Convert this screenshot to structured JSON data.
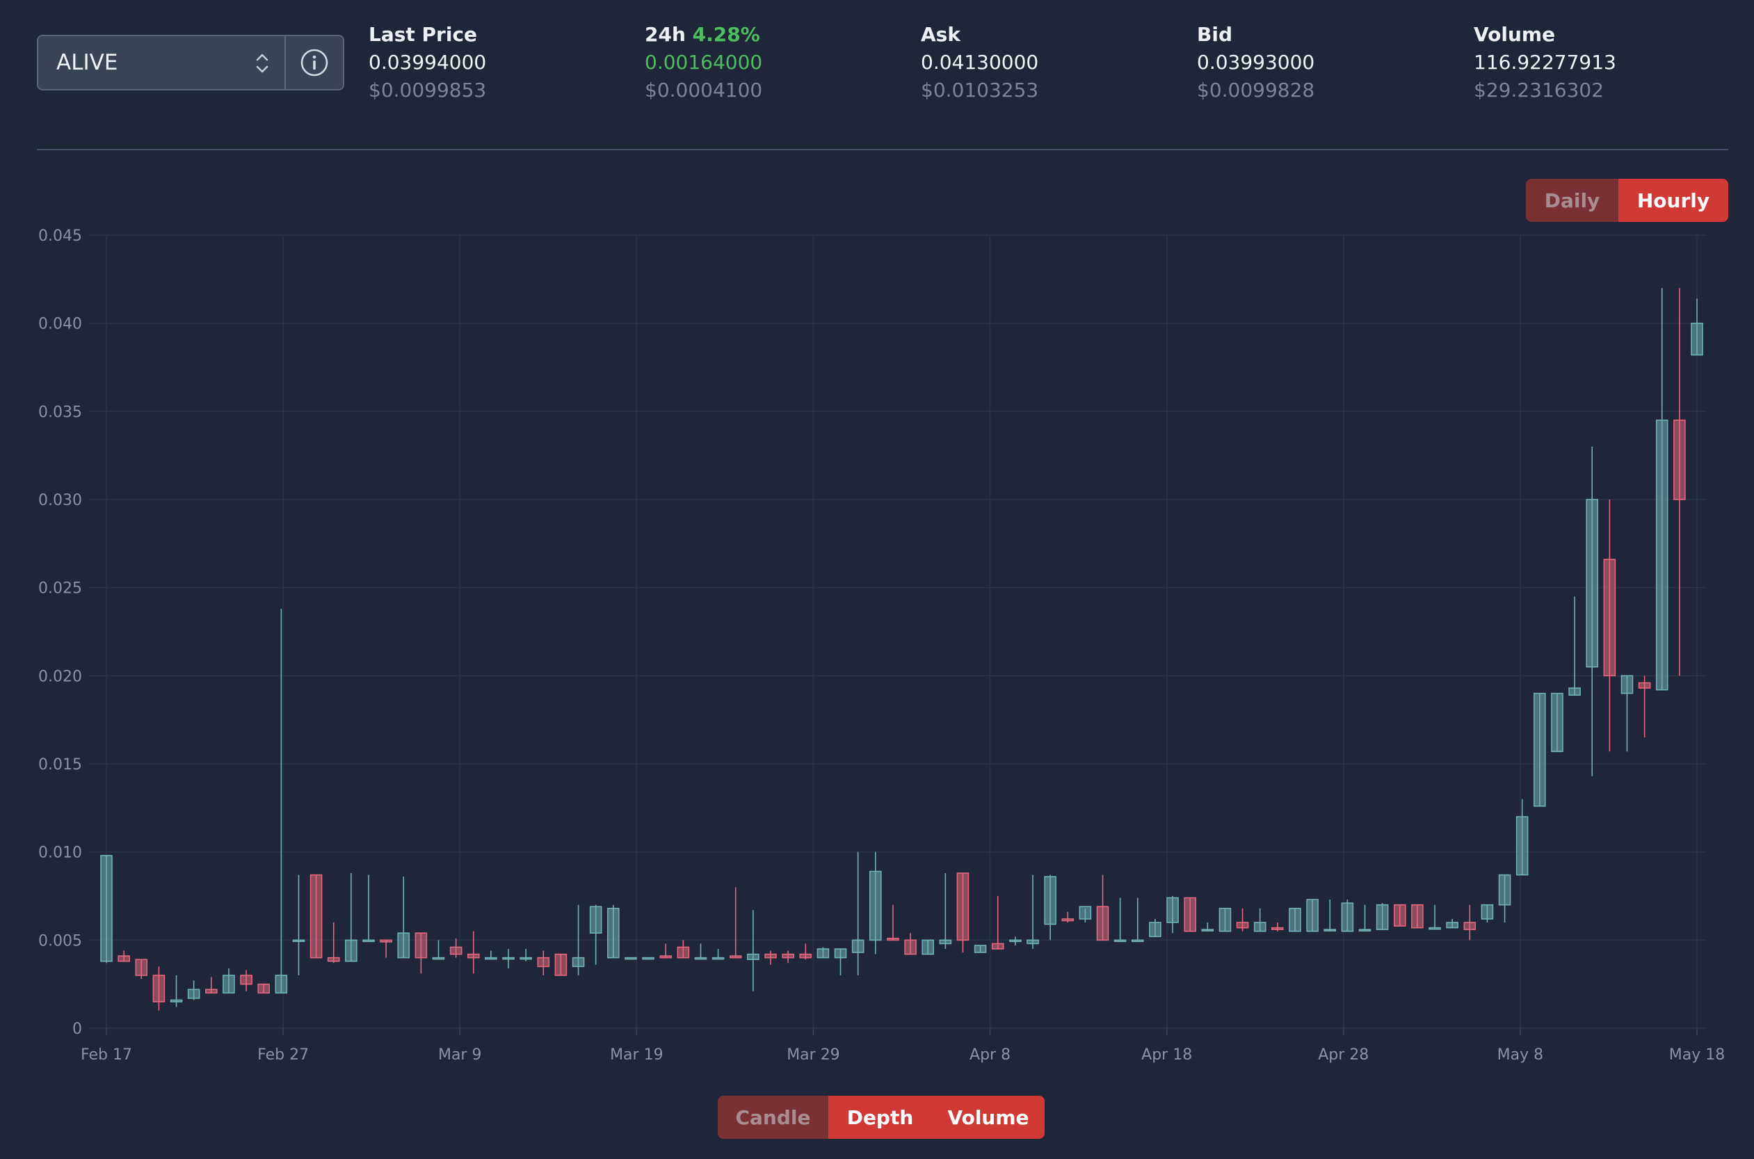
{
  "selector": {
    "value": "ALIVE",
    "chevron_icon": "chevron-up-down-icon",
    "info_icon": "info-circle-icon"
  },
  "stats": {
    "last_price": {
      "label": "Last Price",
      "value": "0.03994000",
      "usd": "$0.0099853"
    },
    "change_24h": {
      "label": "24h",
      "percent": "4.28%",
      "value": "0.00164000",
      "usd": "$0.0004100"
    },
    "ask": {
      "label": "Ask",
      "value": "0.04130000",
      "usd": "$0.0103253"
    },
    "bid": {
      "label": "Bid",
      "value": "0.03993000",
      "usd": "$0.0099828"
    },
    "volume": {
      "label": "Volume",
      "value": "116.92277913",
      "usd": "$29.2316302"
    }
  },
  "interval_toggle": {
    "options": [
      "Daily",
      "Hourly"
    ],
    "active": "Hourly"
  },
  "view_toggle": {
    "options": [
      "Candle",
      "Depth",
      "Volume"
    ],
    "active": "Candle"
  },
  "colors": {
    "up": "#6fb1b6",
    "down": "#e4677d",
    "accent": "#d03935",
    "positive": "#4dbd5f"
  },
  "chart_data": {
    "type": "candlestick",
    "x_start": "Feb 17",
    "x_end": "May 18",
    "x_ticks": [
      "Feb 17",
      "Feb 27",
      "Mar 9",
      "Mar 19",
      "Mar 29",
      "Apr 8",
      "Apr 18",
      "Apr 28",
      "May 8",
      "May 18"
    ],
    "y_ticks": [
      "0",
      "0.005",
      "0.010",
      "0.015",
      "0.020",
      "0.025",
      "0.030",
      "0.035",
      "0.040",
      "0.045"
    ],
    "ylim": [
      0,
      0.045
    ],
    "grid": true,
    "columns": [
      "date",
      "open",
      "high",
      "low",
      "close"
    ],
    "candles": [
      [
        "Feb 17",
        0.0038,
        0.0098,
        0.0037,
        0.0098
      ],
      [
        "Feb 18",
        0.0041,
        0.0044,
        0.0038,
        0.0038
      ],
      [
        "Feb 19",
        0.0039,
        0.0039,
        0.0028,
        0.003
      ],
      [
        "Feb 20",
        0.003,
        0.0035,
        0.001,
        0.0015
      ],
      [
        "Feb 21",
        0.0015,
        0.003,
        0.0012,
        0.0016
      ],
      [
        "Feb 22",
        0.0017,
        0.0027,
        0.0016,
        0.0022
      ],
      [
        "Feb 23",
        0.0022,
        0.0029,
        0.002,
        0.002
      ],
      [
        "Feb 24",
        0.002,
        0.0034,
        0.002,
        0.003
      ],
      [
        "Feb 25",
        0.003,
        0.0033,
        0.0021,
        0.0025
      ],
      [
        "Feb 26",
        0.0025,
        0.0025,
        0.002,
        0.002
      ],
      [
        "Feb 27",
        0.002,
        0.0238,
        0.002,
        0.003
      ],
      [
        "Feb 28",
        0.005,
        0.0087,
        0.003,
        0.005
      ],
      [
        "Mar 1",
        0.0087,
        0.0087,
        0.004,
        0.004
      ],
      [
        "Mar 2",
        0.004,
        0.006,
        0.0037,
        0.0038
      ],
      [
        "Mar 3",
        0.0038,
        0.0088,
        0.0038,
        0.005
      ],
      [
        "Mar 4",
        0.005,
        0.0087,
        0.005,
        0.005
      ],
      [
        "Mar 5",
        0.005,
        0.005,
        0.004,
        0.0049
      ],
      [
        "Mar 6",
        0.004,
        0.0086,
        0.004,
        0.0054
      ],
      [
        "Mar 7",
        0.0054,
        0.0054,
        0.0031,
        0.004
      ],
      [
        "Mar 8",
        0.004,
        0.005,
        0.004,
        0.004
      ],
      [
        "Mar 9",
        0.0046,
        0.0051,
        0.004,
        0.0042
      ],
      [
        "Mar 10",
        0.0042,
        0.0055,
        0.0031,
        0.004
      ],
      [
        "Mar 11",
        0.004,
        0.0044,
        0.0039,
        0.004
      ],
      [
        "Mar 12",
        0.004,
        0.0045,
        0.0034,
        0.004
      ],
      [
        "Mar 13",
        0.004,
        0.0045,
        0.0038,
        0.004
      ],
      [
        "Mar 14",
        0.004,
        0.0044,
        0.003,
        0.0035
      ],
      [
        "Mar 15",
        0.0042,
        0.0042,
        0.003,
        0.003
      ],
      [
        "Mar 16",
        0.0035,
        0.007,
        0.003,
        0.004
      ],
      [
        "Mar 17",
        0.0054,
        0.007,
        0.0036,
        0.0069
      ],
      [
        "Mar 18",
        0.004,
        0.007,
        0.004,
        0.0068
      ],
      [
        "Mar 19",
        0.004,
        0.004,
        0.004,
        0.004
      ],
      [
        "Mar 20",
        0.004,
        0.004,
        0.004,
        0.004
      ],
      [
        "Mar 21",
        0.0041,
        0.0048,
        0.004,
        0.004
      ],
      [
        "Mar 22",
        0.0046,
        0.005,
        0.004,
        0.004
      ],
      [
        "Mar 23",
        0.004,
        0.0048,
        0.004,
        0.004
      ],
      [
        "Mar 24",
        0.004,
        0.0045,
        0.004,
        0.004
      ],
      [
        "Mar 25",
        0.0041,
        0.008,
        0.004,
        0.004
      ],
      [
        "Mar 26",
        0.0039,
        0.0067,
        0.0021,
        0.0042
      ],
      [
        "Mar 27",
        0.0042,
        0.0044,
        0.0036,
        0.004
      ],
      [
        "Mar 28",
        0.0042,
        0.0044,
        0.0037,
        0.004
      ],
      [
        "Mar 29",
        0.0042,
        0.0048,
        0.0039,
        0.004
      ],
      [
        "Mar 30",
        0.004,
        0.0046,
        0.004,
        0.0045
      ],
      [
        "Mar 31",
        0.004,
        0.0045,
        0.003,
        0.0045
      ],
      [
        "Apr 1",
        0.0043,
        0.01,
        0.003,
        0.005
      ],
      [
        "Apr 2",
        0.005,
        0.01,
        0.0042,
        0.0089
      ],
      [
        "Apr 3",
        0.0051,
        0.007,
        0.005,
        0.005
      ],
      [
        "Apr 4",
        0.005,
        0.0054,
        0.0042,
        0.0042
      ],
      [
        "Apr 5",
        0.0042,
        0.005,
        0.0042,
        0.005
      ],
      [
        "Apr 6",
        0.0048,
        0.0088,
        0.0045,
        0.005
      ],
      [
        "Apr 7",
        0.0088,
        0.0088,
        0.0043,
        0.005
      ],
      [
        "Apr 8",
        0.0043,
        0.0047,
        0.0043,
        0.0047
      ],
      [
        "Apr 9",
        0.0048,
        0.0075,
        0.0045,
        0.0045
      ],
      [
        "Apr 10",
        0.005,
        0.0052,
        0.0047,
        0.005
      ],
      [
        "Apr 11",
        0.0048,
        0.0087,
        0.0045,
        0.005
      ],
      [
        "Apr 12",
        0.0059,
        0.0087,
        0.005,
        0.0086
      ],
      [
        "Apr 13",
        0.0062,
        0.0066,
        0.006,
        0.0061
      ],
      [
        "Apr 14",
        0.0062,
        0.0068,
        0.006,
        0.0069
      ],
      [
        "Apr 15",
        0.0069,
        0.0087,
        0.005,
        0.005
      ],
      [
        "Apr 16",
        0.005,
        0.0074,
        0.005,
        0.005
      ],
      [
        "Apr 17",
        0.005,
        0.0074,
        0.005,
        0.005
      ],
      [
        "Apr 18",
        0.0052,
        0.0062,
        0.0052,
        0.006
      ],
      [
        "Apr 19",
        0.006,
        0.0075,
        0.0054,
        0.0074
      ],
      [
        "Apr 20",
        0.0074,
        0.0074,
        0.0055,
        0.0055
      ],
      [
        "Apr 21",
        0.0056,
        0.006,
        0.0055,
        0.0056
      ],
      [
        "Apr 22",
        0.0055,
        0.0068,
        0.0055,
        0.0068
      ],
      [
        "Apr 23",
        0.006,
        0.0068,
        0.0055,
        0.0057
      ],
      [
        "Apr 24",
        0.0055,
        0.0068,
        0.0055,
        0.006
      ],
      [
        "Apr 25",
        0.0057,
        0.006,
        0.0055,
        0.0056
      ],
      [
        "Apr 26",
        0.0055,
        0.0068,
        0.0055,
        0.0068
      ],
      [
        "Apr 27",
        0.0055,
        0.0073,
        0.0055,
        0.0073
      ],
      [
        "Apr 28",
        0.0056,
        0.0073,
        0.0055,
        0.0056
      ],
      [
        "Apr 29",
        0.0055,
        0.0073,
        0.0055,
        0.0071
      ],
      [
        "Apr 30",
        0.0056,
        0.007,
        0.0056,
        0.0056
      ],
      [
        "May 1",
        0.0056,
        0.0071,
        0.0056,
        0.007
      ],
      [
        "May 2",
        0.007,
        0.007,
        0.0058,
        0.0058
      ],
      [
        "May 3",
        0.007,
        0.007,
        0.0057,
        0.0057
      ],
      [
        "May 4",
        0.0057,
        0.007,
        0.0057,
        0.0057
      ],
      [
        "May 5",
        0.0057,
        0.0062,
        0.0057,
        0.006
      ],
      [
        "May 6",
        0.006,
        0.007,
        0.005,
        0.0056
      ],
      [
        "May 7",
        0.0062,
        0.007,
        0.006,
        0.007
      ],
      [
        "May 8",
        0.007,
        0.0087,
        0.006,
        0.0087
      ],
      [
        "May 9",
        0.0087,
        0.013,
        0.0087,
        0.012
      ],
      [
        "May 10",
        0.0126,
        0.019,
        0.0126,
        0.019
      ],
      [
        "May 11",
        0.0157,
        0.019,
        0.0157,
        0.019
      ],
      [
        "May 12",
        0.0189,
        0.0245,
        0.0189,
        0.0193
      ],
      [
        "May 13",
        0.0205,
        0.033,
        0.0143,
        0.03
      ],
      [
        "May 14",
        0.0266,
        0.03,
        0.0157,
        0.02
      ],
      [
        "May 15",
        0.019,
        0.02,
        0.0157,
        0.02
      ],
      [
        "May 16",
        0.0196,
        0.02,
        0.0165,
        0.0193
      ],
      [
        "May 17",
        0.0192,
        0.042,
        0.0192,
        0.0345
      ],
      [
        "May 17b",
        0.0345,
        0.042,
        0.02,
        0.03
      ],
      [
        "May 18",
        0.0382,
        0.0414,
        0.0382,
        0.04
      ]
    ]
  }
}
